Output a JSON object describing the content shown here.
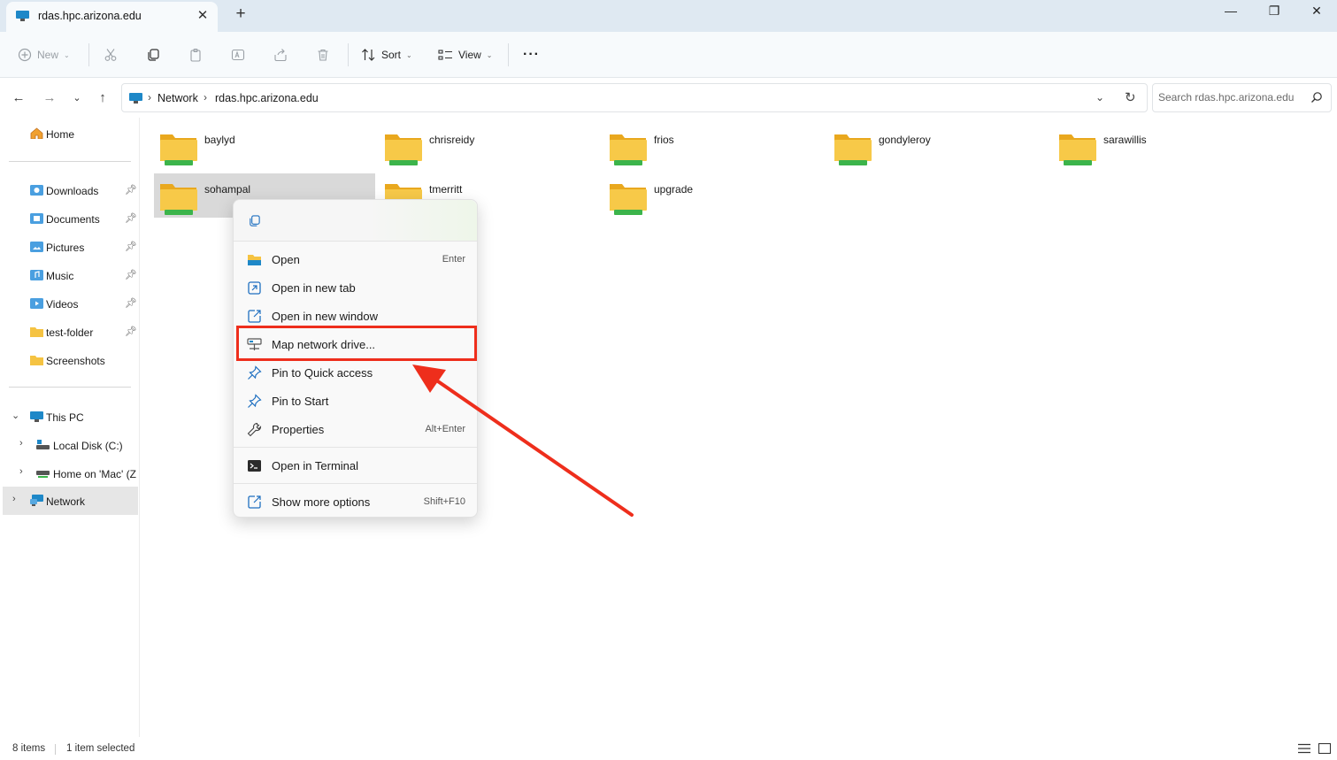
{
  "window": {
    "tab_title": "rdas.hpc.arizona.edu",
    "tab_close": "✕",
    "new_tab": "+",
    "minimize": "—",
    "maximize": "❐",
    "close": "✕"
  },
  "toolbar": {
    "new_label": "New",
    "sort_label": "Sort",
    "view_label": "View",
    "more_label": "···"
  },
  "address": {
    "crumbs": [
      "Network",
      "rdas.hpc.arizona.edu"
    ],
    "search_placeholder": "Search rdas.hpc.arizona.edu"
  },
  "sidebar": {
    "home": "Home",
    "quick": [
      {
        "label": "Downloads",
        "icon": "downloads-icon"
      },
      {
        "label": "Documents",
        "icon": "documents-icon"
      },
      {
        "label": "Pictures",
        "icon": "pictures-icon"
      },
      {
        "label": "Music",
        "icon": "music-icon"
      },
      {
        "label": "Videos",
        "icon": "videos-icon"
      },
      {
        "label": "test-folder",
        "icon": "folder-icon"
      },
      {
        "label": "Screenshots",
        "icon": "folder-icon"
      }
    ],
    "this_pc": "This PC",
    "local_disk": "Local Disk (C:)",
    "home_mac": "Home on 'Mac' (Z",
    "network": "Network"
  },
  "content": {
    "items": [
      "baylyd",
      "chrisreidy",
      "frios",
      "gondyleroy",
      "sarawillis",
      "sohampal",
      "tmerritt",
      "upgrade"
    ],
    "selected": "sohampal"
  },
  "context_menu": {
    "items": [
      {
        "label": "Open",
        "shortcut": "Enter"
      },
      {
        "label": "Open in new tab",
        "shortcut": ""
      },
      {
        "label": "Open in new window",
        "shortcut": ""
      },
      {
        "label": "Map network drive...",
        "shortcut": ""
      },
      {
        "label": "Pin to Quick access",
        "shortcut": ""
      },
      {
        "label": "Pin to Start",
        "shortcut": ""
      },
      {
        "label": "Properties",
        "shortcut": "Alt+Enter"
      },
      {
        "label": "Open in Terminal",
        "shortcut": ""
      },
      {
        "label": "Show more options",
        "shortcut": "Shift+F10"
      }
    ]
  },
  "status": {
    "count": "8 items",
    "selection": "1 item selected"
  },
  "colors": {
    "highlight": "#ee2e1c",
    "folder": "#f5c342",
    "network_green": "#3cb44b"
  }
}
